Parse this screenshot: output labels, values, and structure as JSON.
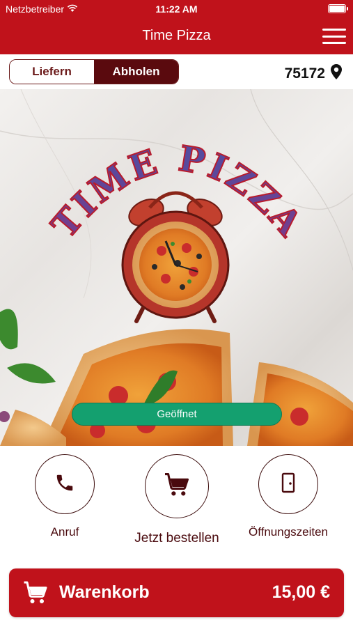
{
  "status_bar": {
    "carrier": "Netzbetreiber",
    "time": "11:22 AM"
  },
  "header": {
    "title": "Time Pizza"
  },
  "toolbar": {
    "delivery_tab": "Liefern",
    "pickup_tab": "Abholen",
    "selected_tab": "Abholen",
    "postal_code": "75172"
  },
  "hero": {
    "logo_text": "TIME PIZZA",
    "status": "Geöffnet"
  },
  "actions": {
    "call": "Anruf",
    "order_now": "Jetzt bestellen",
    "opening_hours": "Öffnungszeiten"
  },
  "cart": {
    "label": "Warenkorb",
    "total": "15,00 €"
  },
  "colors": {
    "brand_red": "#c0121b",
    "dark_maroon": "#5a0a0e",
    "open_green": "#14a06f"
  },
  "icons": [
    "wifi-icon",
    "battery-icon",
    "menu-icon",
    "location-pin-icon",
    "phone-icon",
    "shopping-cart-icon",
    "door-icon"
  ]
}
